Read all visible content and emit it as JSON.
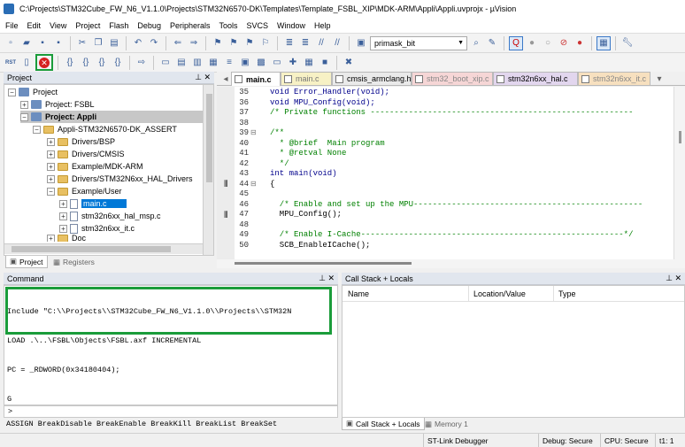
{
  "window": {
    "title": "C:\\Projects\\STM32Cube_FW_N6_V1.1.0\\Projects\\STM32N6570-DK\\Templates\\Template_FSBL_XIP\\MDK-ARM\\Appli\\Appli.uvprojx - µVision"
  },
  "menu": [
    "File",
    "Edit",
    "View",
    "Project",
    "Flash",
    "Debug",
    "Peripherals",
    "Tools",
    "SVCS",
    "Window",
    "Help"
  ],
  "toolbar": {
    "target_combo": "primask_bit"
  },
  "project_panel": {
    "title": "Project",
    "items": [
      "Project",
      "Project: FSBL",
      "Project: Appli",
      "Appli-STM32N6570-DK_ASSERT",
      "Drivers/BSP",
      "Drivers/CMSIS",
      "Example/MDK-ARM",
      "Drivers/STM32N6xx_HAL_Drivers",
      "Example/User",
      "main.c",
      "stm32n6xx_hal_msp.c",
      "stm32n6xx_it.c",
      "Doc"
    ],
    "tabs": [
      "Project",
      "Registers"
    ]
  },
  "editor": {
    "tabs": [
      "main.c",
      "main.c",
      "cmsis_armclang.h",
      "stm32_boot_xip.c",
      "stm32n6xx_hal.c",
      "stm32n6xx_it.c"
    ],
    "lines": [
      {
        "n": "35",
        "t": "void Error_Handler(void);"
      },
      {
        "n": "36",
        "t": "void MPU_Config(void);"
      },
      {
        "n": "37",
        "t": "/* Private functions -------------------------------------------------------"
      },
      {
        "n": "38",
        "t": ""
      },
      {
        "n": "39",
        "t": "/**"
      },
      {
        "n": "40",
        "t": "  * @brief  Main program"
      },
      {
        "n": "41",
        "t": "  * @retval None"
      },
      {
        "n": "42",
        "t": "  */"
      },
      {
        "n": "43",
        "t": "int main(void)"
      },
      {
        "n": "44",
        "t": "{"
      },
      {
        "n": "45",
        "t": ""
      },
      {
        "n": "46",
        "t": "  /* Enable and set up the MPU------------------------------------------------"
      },
      {
        "n": "47",
        "t": "  MPU_Config();"
      },
      {
        "n": "48",
        "t": ""
      },
      {
        "n": "49",
        "t": "  /* Enable I-Cache-------------------------------------------------------*/"
      },
      {
        "n": "50",
        "t": "  SCB_EnableICache();"
      }
    ]
  },
  "command_panel": {
    "title": "Command",
    "lines": [
      "Include \"C:\\\\Projects\\\\STM32Cube_FW_N6_V1.1.0\\\\Projects\\\\STM32N",
      "LOAD .\\..\\FSBL\\Objects\\FSBL.axf INCREMENTAL",
      "PC = _RDWORD(0x34180404);",
      "G"
    ],
    "prompt": ">",
    "hint": "ASSIGN BreakDisable BreakEnable BreakKill BreakList BreakSet"
  },
  "callstack_panel": {
    "title": "Call Stack + Locals",
    "columns": [
      "Name",
      "Location/Value",
      "Type"
    ],
    "tabs": [
      "Call Stack + Locals",
      "Memory 1"
    ]
  },
  "status": {
    "debugger": "ST-Link Debugger",
    "debug": "Debug: Secure",
    "cpu": "CPU: Secure",
    "t1": "t1: 1"
  },
  "colors": {
    "highlight_green": "#1a9c3a",
    "selection_blue": "#0078d7"
  }
}
